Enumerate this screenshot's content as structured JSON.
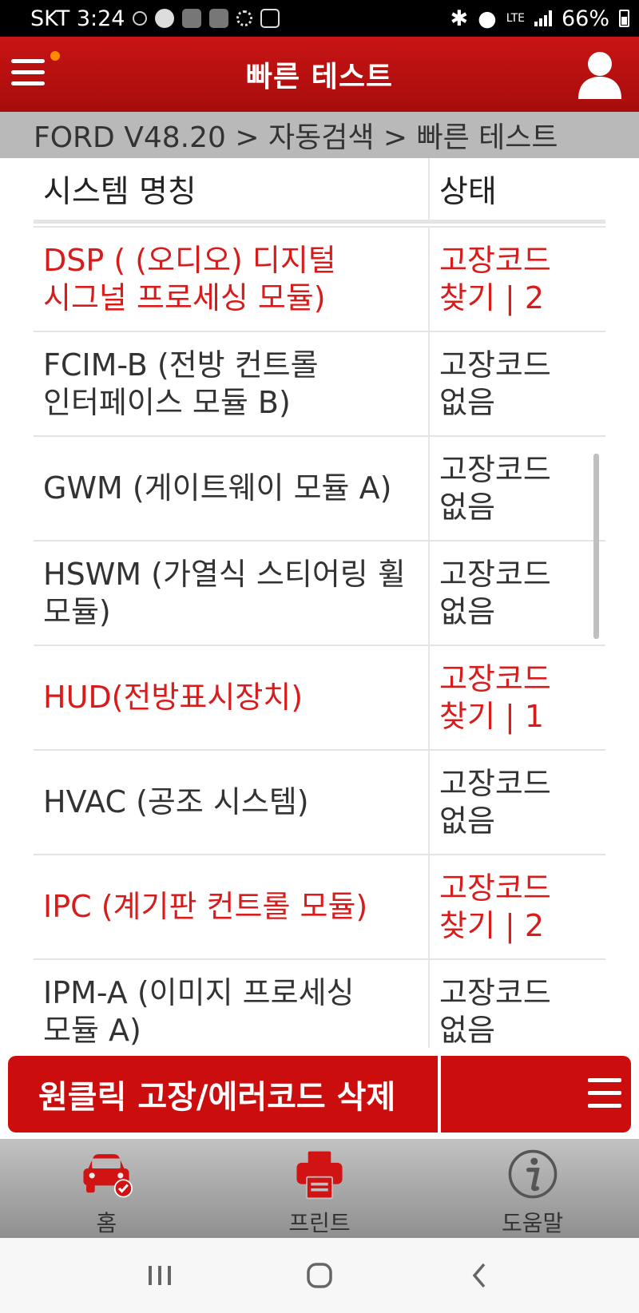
{
  "status_bar": {
    "carrier_time": "SKT 3:24",
    "network": "LTE",
    "battery": "66%"
  },
  "app_bar": {
    "title": "빠른 테스트"
  },
  "breadcrumb": "FORD V48.20 > 자동검색 > 빠른 테스트",
  "table": {
    "columns": [
      "시스템 명칭",
      "상태"
    ],
    "rows": [
      {
        "name_line1": "DSP ( (오디오) 디지털",
        "name_line2": "시그널 프로세싱 모듈)",
        "status_line1": "고장코드",
        "status_line2": "찾기 | 2",
        "fault": true
      },
      {
        "name_line1": "FCIM-B (전방 컨트롤",
        "name_line2": "인터페이스 모듈 B)",
        "status_line1": "고장코드",
        "status_line2": "없음",
        "fault": false
      },
      {
        "name_line1": "GWM (게이트웨이 모듈 A)",
        "name_line2": "",
        "status_line1": "고장코드",
        "status_line2": "없음",
        "fault": false
      },
      {
        "name_line1": "HSWM (가열식 스티어링 휠",
        "name_line2": "모듈)",
        "status_line1": "고장코드",
        "status_line2": "없음",
        "fault": false
      },
      {
        "name_line1": "HUD(전방표시장치)",
        "name_line2": "",
        "status_line1": "고장코드",
        "status_line2": "찾기 | 1",
        "fault": true
      },
      {
        "name_line1": "HVAC (공조 시스템)",
        "name_line2": "",
        "status_line1": "고장코드",
        "status_line2": "없음",
        "fault": false
      },
      {
        "name_line1": "IPC (계기판 컨트롤 모듈)",
        "name_line2": "",
        "status_line1": "고장코드",
        "status_line2": "찾기 | 2",
        "fault": true
      },
      {
        "name_line1": "IPM-A (이미지 프로세싱",
        "name_line2": "모듈 A)",
        "status_line1": "고장코드",
        "status_line2": "없음",
        "fault": false
      }
    ]
  },
  "action_bar": {
    "clear_codes_label": "원클릭 고장/에러코드 삭제"
  },
  "bottom_nav": {
    "home_label": "홈",
    "print_label": "프린트",
    "help_label": "도움말"
  },
  "colors": {
    "brand_red": "#c81414",
    "fault_red": "#d81c1c"
  },
  "icons": {
    "menu": "hamburger-icon",
    "user": "user-icon",
    "home": "car-check-icon",
    "print": "printer-icon",
    "help": "info-icon"
  }
}
